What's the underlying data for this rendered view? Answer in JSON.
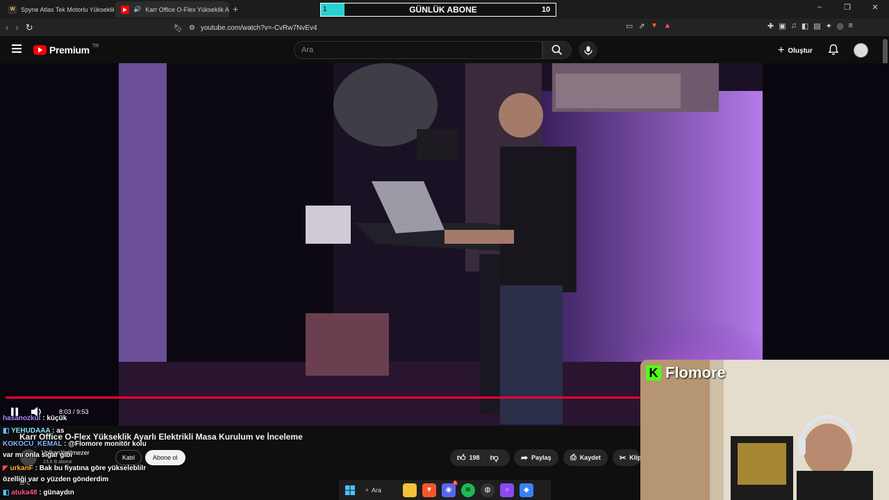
{
  "browser": {
    "tabs": [
      {
        "title": "Spyne Atlas Tek Motorlu Yükseklik Ay",
        "active": false
      },
      {
        "title": "Karr Office O-Flex Yükseklik A",
        "active": true
      }
    ],
    "new_tab": "+",
    "window_controls": [
      "–",
      "❐",
      "✕"
    ],
    "url": "youtube.com/watch?v=-CvRw7NvEv4"
  },
  "abone_widget": {
    "current": "1",
    "label": "GÜNLÜK ABONE",
    "goal": "10",
    "progress": 0.1
  },
  "header": {
    "logo_text": "Premium",
    "region": "TR",
    "search_placeholder": "Ara",
    "create_label": "Oluştur"
  },
  "player": {
    "time": "8:03 / 9:53",
    "progress": 0.8
  },
  "video": {
    "title": "Karr Office O-Flex Yükseklik Ayarlı Elektrikli Masa Kurulum ve İnceleme",
    "channel": "VolkanYetilmezer",
    "subs": "23,6 B abone",
    "join_label": "Katıl",
    "subscribe_label": "Abone ol",
    "likes": "198",
    "share_label": "Paylaş",
    "save_label": "Kaydet",
    "clip_label": "Klip"
  },
  "chat": [
    {
      "user": "hasanozkul",
      "msg": "küçük",
      "color": "#b18cff"
    },
    {
      "user": "YEHUDAAA",
      "msg": "as",
      "color": "#8ee6ff"
    },
    {
      "user": "KOKOCU_KEMAL",
      "msg": "@Flomore monitör kolu",
      "color": "#8ab4ff"
    },
    {
      "user": "",
      "msg": "var mı onla sigar gibi",
      "color": "#fff"
    },
    {
      "user": "urkanF",
      "msg": "Bak bu fiyatına göre yükseleblilr",
      "color": "#ffb347"
    },
    {
      "user": "",
      "msg": "özelliği var o yüzden gönderdim",
      "color": "#fff"
    },
    {
      "user": "atuka48",
      "msg": "günaydın",
      "color": "#ff5c8a"
    }
  ],
  "webcam": {
    "brand": "Flomore"
  },
  "weather": "12°C",
  "taskbar": {
    "search_label": "Ara",
    "discord_badge": "5"
  },
  "colors": {
    "accent_red": "#ff0033",
    "abone_fill": "#2ad1d1",
    "chat_bg": "#0f0f0f"
  }
}
